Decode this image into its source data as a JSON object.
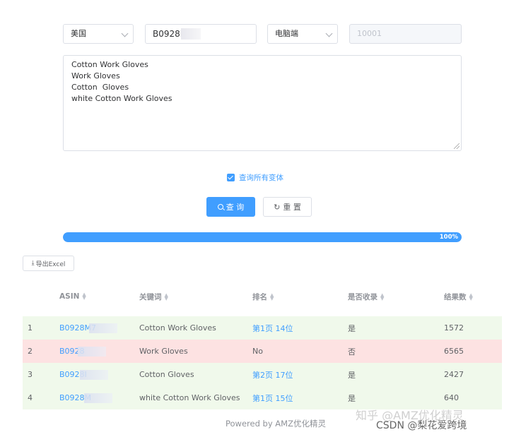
{
  "filters": {
    "country": "美国",
    "asin": "B0928M",
    "device": "电脑端",
    "zipcode_placeholder": "10001"
  },
  "keywords": [
    "Cotton Work Gloves",
    "Work Gloves",
    "Cotton  Gloves",
    "white Cotton Work Gloves"
  ],
  "options": {
    "query_all_variants": "查询所有变体"
  },
  "buttons": {
    "query": "查 询",
    "reset": "重 置",
    "export": "导出Excel"
  },
  "progress": {
    "value": 100,
    "label": "100%"
  },
  "table": {
    "headers": [
      "ASIN",
      "关键词",
      "排名",
      "是否收录",
      "结果数"
    ],
    "rows": [
      {
        "index": "1",
        "asin": "B0928M7",
        "keyword": "Cotton Work Gloves",
        "rank": "第1页 14位",
        "indexed": "是",
        "results": "1572",
        "status": "green"
      },
      {
        "index": "2",
        "asin": "B0928",
        "keyword": "Work Gloves",
        "rank": "No",
        "indexed": "否",
        "results": "6565",
        "status": "red"
      },
      {
        "index": "3",
        "asin": "B0928I",
        "keyword": "Cotton Gloves",
        "rank": "第2页 17位",
        "indexed": "是",
        "results": "2427",
        "status": "green"
      },
      {
        "index": "4",
        "asin": "B0928M",
        "keyword": "white Cotton Work Gloves",
        "rank": "第1页 15位",
        "indexed": "是",
        "results": "640",
        "status": "green"
      }
    ]
  },
  "footer": "Powered by AMZ优化精灵",
  "watermark": {
    "line1": "知乎 @AMZ优化精灵",
    "line2": "CSDN @梨花爱跨境"
  },
  "colors": {
    "primary": "#409eff",
    "row_ok": "#f0f9eb",
    "row_fail": "#fde2e2"
  }
}
